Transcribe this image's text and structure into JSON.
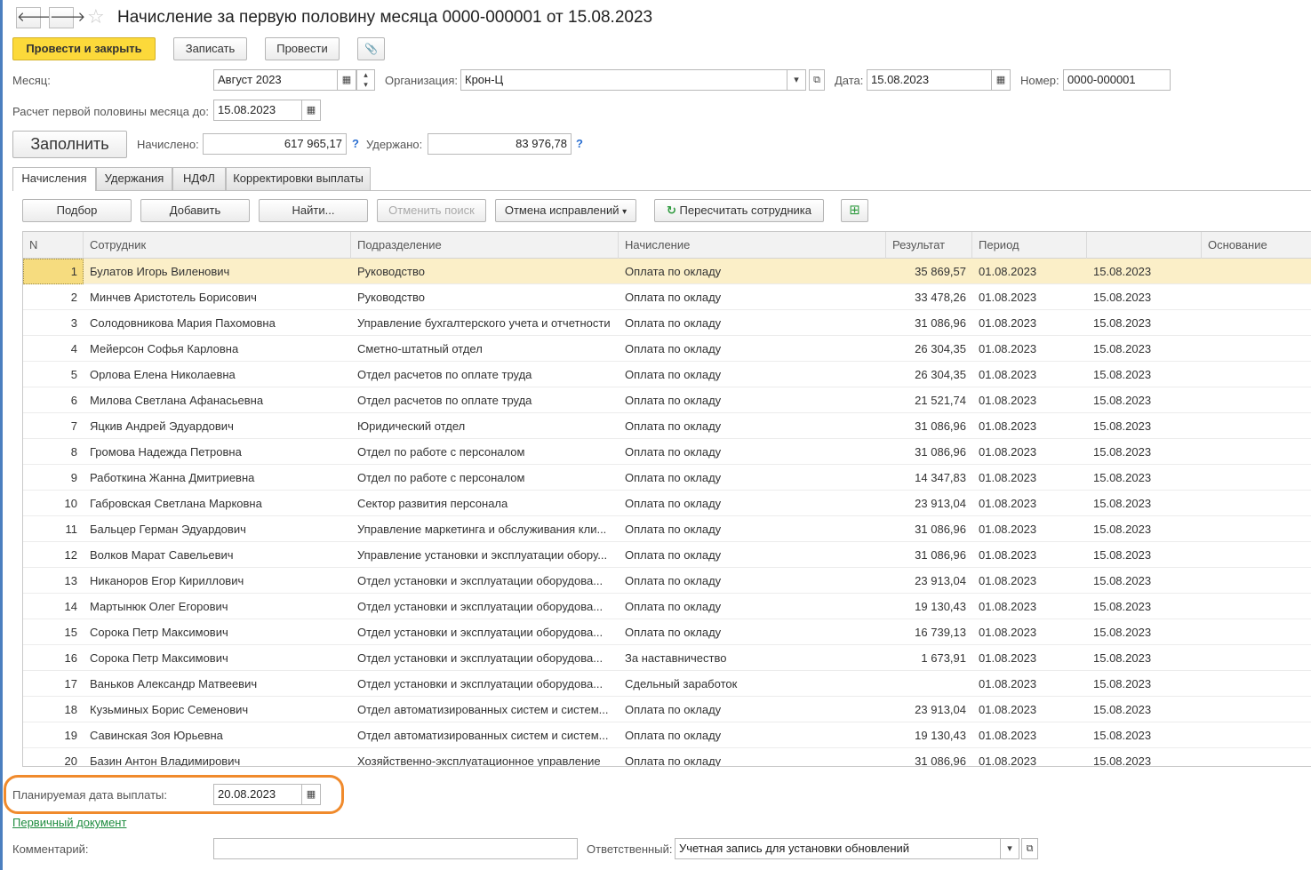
{
  "window": {
    "title": "Начисление за первую половину месяца 0000-000001 от 15.08.2023",
    "back_glyph": "🡐",
    "forward_glyph": "🡒",
    "star_glyph": "☆"
  },
  "toolbar": {
    "post_close": "Провести и закрыть",
    "save": "Записать",
    "post": "Провести",
    "attach_glyph": "📎"
  },
  "header": {
    "month_label": "Месяц:",
    "month_value": "Август 2023",
    "org_label": "Организация:",
    "org_value": "Крон-Ц",
    "date_label": "Дата:",
    "date_value": "15.08.2023",
    "number_label": "Номер:",
    "number_value": "0000-000001",
    "calc_label": "Расчет первой половины месяца до:",
    "calc_value": "15.08.2023",
    "fill_button": "Заполнить",
    "accrued_label": "Начислено:",
    "accrued_value": "617 965,17",
    "withheld_label": "Удержано:",
    "withheld_value": "83 976,78",
    "help_glyph": "?",
    "calendar_glyph": "▦",
    "dropdown_glyph": "▾",
    "open_glyph": "⧉",
    "up_glyph": "▴",
    "down_glyph": "▾"
  },
  "tabs": [
    "Начисления",
    "Удержания",
    "НДФЛ",
    "Корректировки выплаты"
  ],
  "table_toolbar": {
    "select": "Подбор",
    "add": "Добавить",
    "find": "Найти...",
    "cancel_search": "Отменить поиск",
    "cancel_fixes": "Отмена исправлений",
    "recalc": "Пересчитать сотрудника",
    "recalc_glyph": "↻",
    "table_glyph": "⊞"
  },
  "columns": [
    "N",
    "Сотрудник",
    "Подразделение",
    "Начисление",
    "Результат",
    "Период",
    "",
    "Основание"
  ],
  "rows": [
    {
      "n": "1",
      "employee": "Булатов Игорь Виленович",
      "dept": "Руководство",
      "accrual": "Оплата по окладу",
      "result": "35 869,57",
      "from": "01.08.2023",
      "to": "15.08.2023"
    },
    {
      "n": "2",
      "employee": "Минчев Аристотель Борисович",
      "dept": "Руководство",
      "accrual": "Оплата по окладу",
      "result": "33 478,26",
      "from": "01.08.2023",
      "to": "15.08.2023"
    },
    {
      "n": "3",
      "employee": "Солодовникова Мария Пахомовна",
      "dept": "Управление бухгалтерского учета и отчетности",
      "accrual": "Оплата по окладу",
      "result": "31 086,96",
      "from": "01.08.2023",
      "to": "15.08.2023"
    },
    {
      "n": "4",
      "employee": "Мейерсон Софья Карловна",
      "dept": "Сметно-штатный отдел",
      "accrual": "Оплата по окладу",
      "result": "26 304,35",
      "from": "01.08.2023",
      "to": "15.08.2023"
    },
    {
      "n": "5",
      "employee": "Орлова Елена Николаевна",
      "dept": "Отдел расчетов по оплате труда",
      "accrual": "Оплата по окладу",
      "result": "26 304,35",
      "from": "01.08.2023",
      "to": "15.08.2023"
    },
    {
      "n": "6",
      "employee": "Милова Светлана Афанасьевна",
      "dept": "Отдел расчетов по оплате труда",
      "accrual": "Оплата по окладу",
      "result": "21 521,74",
      "from": "01.08.2023",
      "to": "15.08.2023"
    },
    {
      "n": "7",
      "employee": "Яцкив Андрей Эдуардович",
      "dept": "Юридический отдел",
      "accrual": "Оплата по окладу",
      "result": "31 086,96",
      "from": "01.08.2023",
      "to": "15.08.2023"
    },
    {
      "n": "8",
      "employee": "Громова Надежда Петровна",
      "dept": "Отдел по работе с персоналом",
      "accrual": "Оплата по окладу",
      "result": "31 086,96",
      "from": "01.08.2023",
      "to": "15.08.2023"
    },
    {
      "n": "9",
      "employee": "Работкина Жанна Дмитриевна",
      "dept": "Отдел по работе с персоналом",
      "accrual": "Оплата по окладу",
      "result": "14 347,83",
      "from": "01.08.2023",
      "to": "15.08.2023"
    },
    {
      "n": "10",
      "employee": "Габровская Светлана Марковна",
      "dept": "Сектор развития персонала",
      "accrual": "Оплата по окладу",
      "result": "23 913,04",
      "from": "01.08.2023",
      "to": "15.08.2023"
    },
    {
      "n": "11",
      "employee": "Бальцер Герман Эдуардович",
      "dept": "Управление маркетинга и обслуживания кли...",
      "accrual": "Оплата по окладу",
      "result": "31 086,96",
      "from": "01.08.2023",
      "to": "15.08.2023"
    },
    {
      "n": "12",
      "employee": "Волков Марат Савельевич",
      "dept": "Управление установки и эксплуатации обору...",
      "accrual": "Оплата по окладу",
      "result": "31 086,96",
      "from": "01.08.2023",
      "to": "15.08.2023"
    },
    {
      "n": "13",
      "employee": "Никаноров Егор Кириллович",
      "dept": "Отдел установки и эксплуатации оборудова...",
      "accrual": "Оплата по окладу",
      "result": "23 913,04",
      "from": "01.08.2023",
      "to": "15.08.2023"
    },
    {
      "n": "14",
      "employee": "Мартынюк Олег Егорович",
      "dept": "Отдел установки и эксплуатации оборудова...",
      "accrual": "Оплата по окладу",
      "result": "19 130,43",
      "from": "01.08.2023",
      "to": "15.08.2023"
    },
    {
      "n": "15",
      "employee": "Сорока Петр Максимович",
      "dept": "Отдел установки и эксплуатации оборудова...",
      "accrual": "Оплата по окладу",
      "result": "16 739,13",
      "from": "01.08.2023",
      "to": "15.08.2023"
    },
    {
      "n": "16",
      "employee": "Сорока Петр Максимович",
      "dept": "Отдел установки и эксплуатации оборудова...",
      "accrual": "За наставничество",
      "result": "1 673,91",
      "from": "01.08.2023",
      "to": "15.08.2023"
    },
    {
      "n": "17",
      "employee": "Ваньков Александр Матвеевич",
      "dept": "Отдел установки и эксплуатации оборудова...",
      "accrual": "Сдельный заработок",
      "result": "",
      "from": "01.08.2023",
      "to": "15.08.2023"
    },
    {
      "n": "18",
      "employee": "Кузьминых Борис Семенович",
      "dept": "Отдел автоматизированных систем и систем...",
      "accrual": "Оплата по окладу",
      "result": "23 913,04",
      "from": "01.08.2023",
      "to": "15.08.2023"
    },
    {
      "n": "19",
      "employee": "Савинская Зоя Юрьевна",
      "dept": "Отдел автоматизированных систем и систем...",
      "accrual": "Оплата по окладу",
      "result": "19 130,43",
      "from": "01.08.2023",
      "to": "15.08.2023"
    },
    {
      "n": "20",
      "employee": "Базин Антон Владимирович",
      "dept": "Хозяйственно-эксплуатационное управление",
      "accrual": "Оплата по окладу",
      "result": "31 086,96",
      "from": "01.08.2023",
      "to": "15.08.2023"
    }
  ],
  "footer": {
    "pay_date_label": "Планируемая дата выплаты:",
    "pay_date_value": "20.08.2023",
    "primary_doc_link": "Первичный документ",
    "comment_label": "Комментарий:",
    "comment_value": "",
    "responsible_label": "Ответственный:",
    "responsible_value": "Учетная запись для установки обновлений"
  },
  "colors": {
    "primary_button": "#fcd93a",
    "selected_row": "#fbefc8",
    "highlight_outline": "#f08a2c",
    "link": "#1e8c3f"
  }
}
